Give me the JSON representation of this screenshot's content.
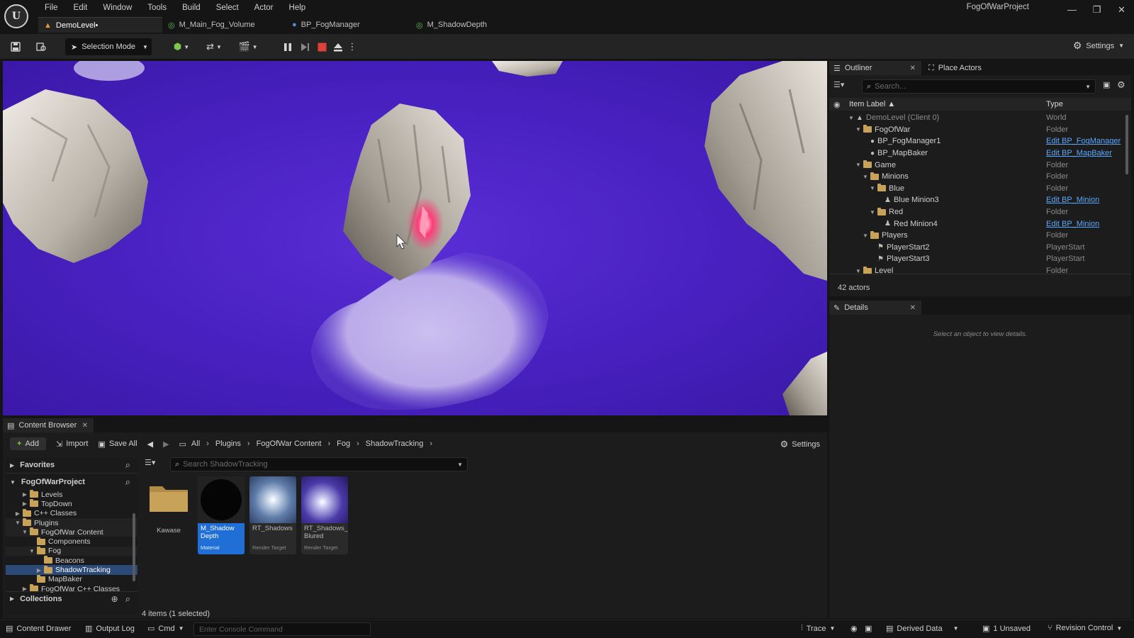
{
  "menu": [
    "File",
    "Edit",
    "Window",
    "Tools",
    "Build",
    "Select",
    "Actor",
    "Help"
  ],
  "project_title": "FogOfWarProject",
  "window_controls": [
    "—",
    "❐",
    "✕"
  ],
  "tabs": [
    {
      "label": "DemoLevel•",
      "icon": "level-icon"
    },
    {
      "label": "M_Main_Fog_Volume",
      "icon": "material-icon"
    },
    {
      "label": "BP_FogManager",
      "icon": "blueprint-icon"
    },
    {
      "label": "M_ShadowDepth",
      "icon": "material-icon"
    }
  ],
  "toolbar": {
    "selection_mode": "Selection Mode",
    "settings": "Settings"
  },
  "outliner": {
    "tab_label": "Outliner",
    "place_actors_label": "Place Actors",
    "search_placeholder": "Search...",
    "col_label": "Item Label ▲",
    "col_type": "Type",
    "rows": [
      {
        "label": "DemoLevel (Client 0)",
        "type": "World",
        "link": false
      },
      {
        "label": "FogOfWar",
        "type": "Folder",
        "link": false
      },
      {
        "label": "BP_FogManager1",
        "type": "Edit BP_FogManager",
        "link": true
      },
      {
        "label": "BP_MapBaker",
        "type": "Edit BP_MapBaker",
        "link": true
      },
      {
        "label": "Game",
        "type": "Folder",
        "link": false
      },
      {
        "label": "Minions",
        "type": "Folder",
        "link": false
      },
      {
        "label": "Blue",
        "type": "Folder",
        "link": false
      },
      {
        "label": "Blue Minion3",
        "type": "Edit BP_Minion",
        "link": true
      },
      {
        "label": "Red",
        "type": "Folder",
        "link": false
      },
      {
        "label": "Red Minion4",
        "type": "Edit BP_Minion",
        "link": true
      },
      {
        "label": "Players",
        "type": "Folder",
        "link": false
      },
      {
        "label": "PlayerStart2",
        "type": "PlayerStart",
        "link": false
      },
      {
        "label": "PlayerStart3",
        "type": "PlayerStart",
        "link": false
      },
      {
        "label": "Level",
        "type": "Folder",
        "link": false
      }
    ],
    "actor_count": "42 actors"
  },
  "details": {
    "tab_label": "Details",
    "empty_message": "Select an object to view details."
  },
  "content_browser": {
    "tab_label": "Content Browser",
    "add_label": "Add",
    "import_label": "Import",
    "save_all_label": "Save All",
    "breadcrumb": [
      "All",
      "Plugins",
      "FogOfWar Content",
      "Fog",
      "ShadowTracking"
    ],
    "settings_label": "Settings",
    "favorites_label": "Favorites",
    "project_label": "FogOfWarProject",
    "collections_label": "Collections",
    "search_placeholder": "Search ShadowTracking",
    "tree": [
      {
        "label": "Levels"
      },
      {
        "label": "TopDown"
      },
      {
        "label": "C++ Classes"
      },
      {
        "label": "Plugins"
      },
      {
        "label": "FogOfWar Content"
      },
      {
        "label": "Components"
      },
      {
        "label": "Fog"
      },
      {
        "label": "Beacons"
      },
      {
        "label": "ShadowTracking"
      },
      {
        "label": "MapBaker"
      },
      {
        "label": "FogOfWar C++ Classes"
      }
    ],
    "assets": [
      {
        "name": "Kawase",
        "type": ""
      },
      {
        "name": "M_Shadow Depth",
        "type": "Material"
      },
      {
        "name": "RT_Shadows",
        "type": "Render Target"
      },
      {
        "name": "RT_Shadows_ Blured",
        "type": "Render Target"
      }
    ],
    "status": "4 items (1 selected)"
  },
  "statusbar": {
    "content_drawer": "Content Drawer",
    "output_log": "Output Log",
    "cmd": "Cmd",
    "console_placeholder": "Enter Console Command",
    "trace": "Trace",
    "derived_data": "Derived Data",
    "unsaved": "1 Unsaved",
    "revision_control": "Revision Control"
  },
  "colors": {
    "accent_blue": "#1f6fd6",
    "link_blue": "#5aa7ff",
    "fog_purple": "#4b22c4",
    "stop_red": "#e0403a",
    "folder": "#c9a25a"
  }
}
